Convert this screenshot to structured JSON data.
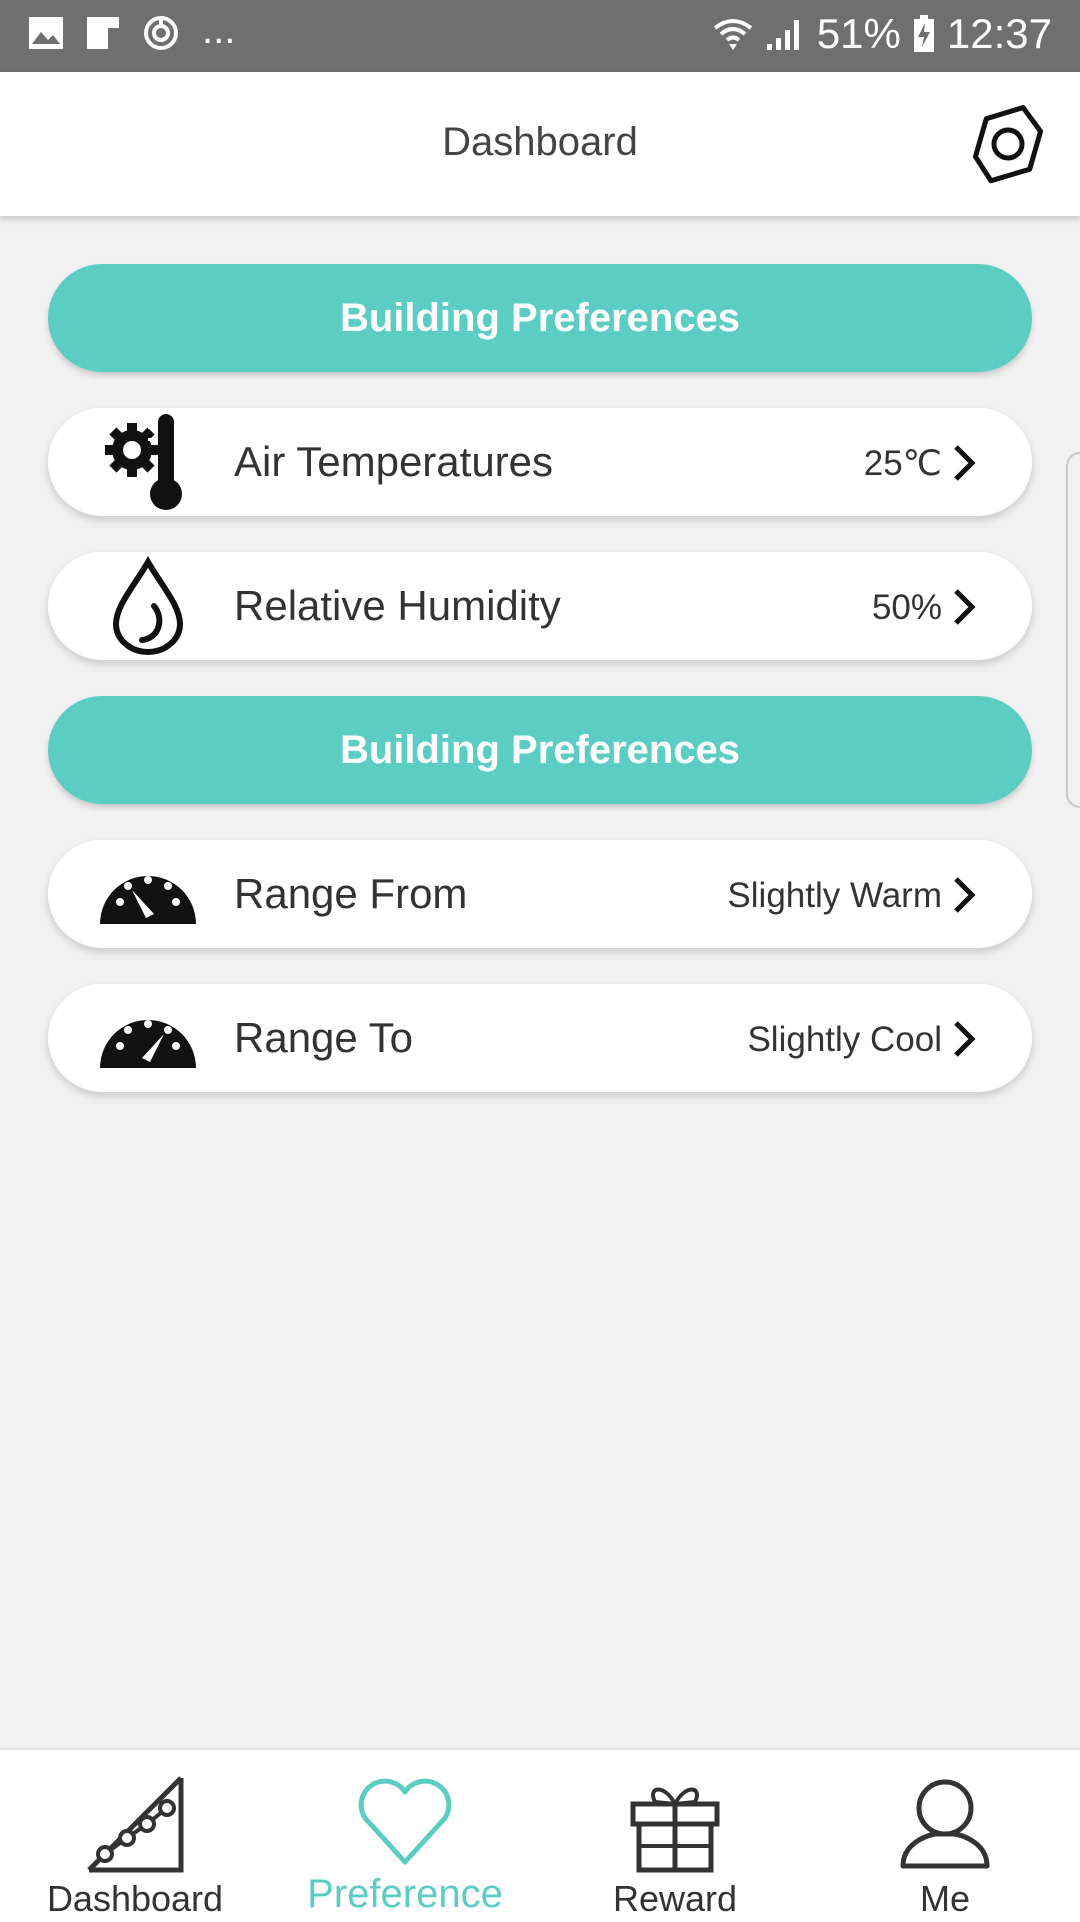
{
  "status_bar": {
    "dots": "...",
    "battery_percent": "51%",
    "time": "12:37"
  },
  "header": {
    "title": "Dashboard"
  },
  "sections": [
    {
      "title": "Building Preferences",
      "rows": [
        {
          "label": "Air Temperatures",
          "value": "25℃",
          "icon": "thermometer-gear-icon"
        },
        {
          "label": "Relative Humidity",
          "value": "50%",
          "icon": "water-drop-icon"
        }
      ]
    },
    {
      "title": "Building Preferences",
      "rows": [
        {
          "label": "Range From",
          "value": "Slightly Warm",
          "icon": "gauge-icon"
        },
        {
          "label": "Range To",
          "value": "Slightly Cool",
          "icon": "gauge-icon"
        }
      ]
    }
  ],
  "bottom_nav": [
    {
      "label": "Dashboard",
      "icon": "chart-icon",
      "active": false
    },
    {
      "label": "Preference",
      "icon": "heart-icon",
      "active": true
    },
    {
      "label": "Reward",
      "icon": "gift-icon",
      "active": false
    },
    {
      "label": "Me",
      "icon": "user-icon",
      "active": false
    }
  ],
  "colors": {
    "accent": "#5ccdc2",
    "status_bar": "#6f6f6f",
    "background": "#f1f1f1"
  }
}
